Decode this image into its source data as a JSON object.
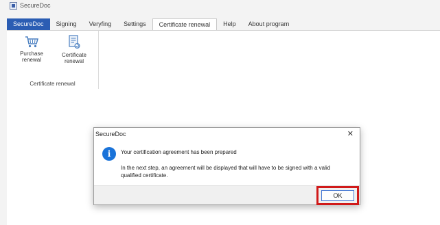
{
  "window": {
    "title": "SecureDoc"
  },
  "tabs": [
    {
      "label": "SecureDoc"
    },
    {
      "label": "Signing"
    },
    {
      "label": "Veryfing"
    },
    {
      "label": "Settings"
    },
    {
      "label": "Certificate renewal"
    },
    {
      "label": "Help"
    },
    {
      "label": "About program"
    }
  ],
  "ribbon": {
    "group_label": "Certificate renewal",
    "buttons": [
      {
        "label_line1": "Purchase",
        "label_line2": "renewal",
        "icon": "cart-icon"
      },
      {
        "label_line1": "Certificate",
        "label_line2": "renewal",
        "icon": "certificate-icon"
      }
    ]
  },
  "dialog": {
    "title": "SecureDoc",
    "close_glyph": "✕",
    "icon_glyph": "i",
    "message_main": "Your certification agreement has been prepared",
    "message_detail": "In the next step, an agreement will be displayed that will have to be signed with a valid qualified certificate.",
    "ok_label": "OK"
  },
  "colors": {
    "accent": "#2b5db3",
    "highlight": "#d01a1a",
    "info": "#1a73d9"
  }
}
